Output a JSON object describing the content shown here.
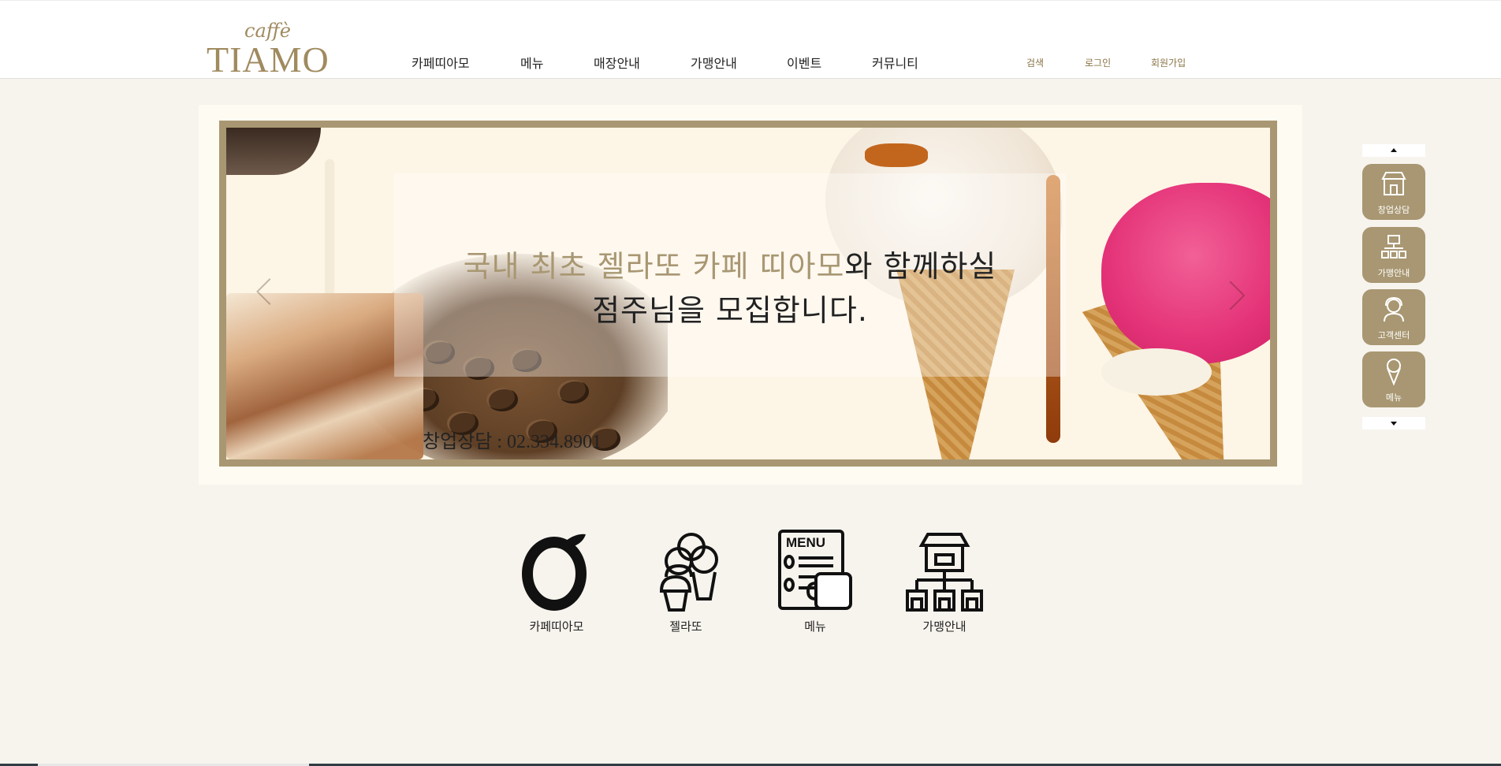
{
  "header": {
    "logo": {
      "small": "caffè",
      "main": "TIAMO"
    },
    "nav": [
      "카페띠아모",
      "메뉴",
      "매장안내",
      "가맹안내",
      "이벤트",
      "커뮤니티"
    ],
    "util": [
      "검색",
      "로그인",
      "회원가입"
    ]
  },
  "hero": {
    "headline_gold": "국내 최초 젤라또 카페 띠아모",
    "headline_rest": "와 함께하실",
    "headline_line2": "점주님을 모집합니다.",
    "phone": "창업상담 : 02.334.8901"
  },
  "quick": [
    {
      "label": "카페띠아모",
      "icon": "tiamo-logo-icon"
    },
    {
      "label": "젤라또",
      "icon": "ice-cream-icon"
    },
    {
      "label": "메뉴",
      "icon": "menu-board-icon"
    },
    {
      "label": "가맹안내",
      "icon": "franchise-store-icon"
    }
  ],
  "side": [
    {
      "label": "창업상담",
      "icon": "store-icon"
    },
    {
      "label": "가맹안내",
      "icon": "franchise-icon"
    },
    {
      "label": "고객센터",
      "icon": "headset-icon"
    },
    {
      "label": "메뉴",
      "icon": "ice-cream-icon"
    }
  ],
  "colors": {
    "accent": "#a89772",
    "background": "#f7f4ee",
    "header": "#ffffff"
  }
}
